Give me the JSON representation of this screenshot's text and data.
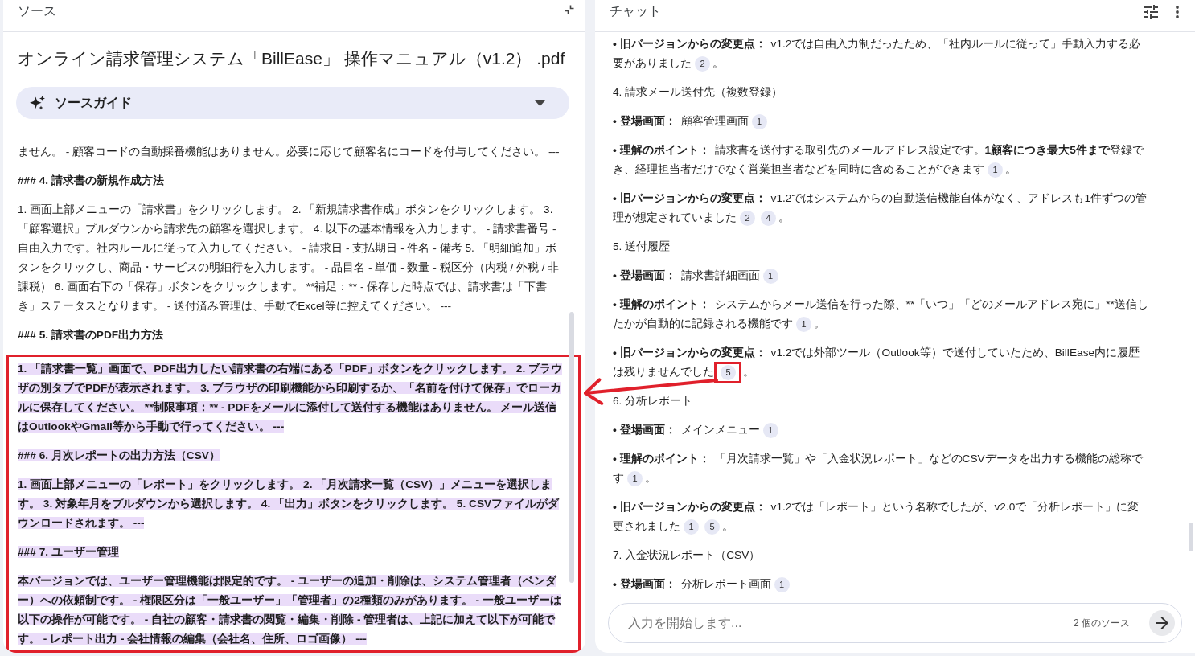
{
  "source_panel": {
    "title": "ソース",
    "document_title": "オンライン請求管理システム「BillEase」 操作マニュアル（v1.2） .pdf",
    "source_guide": {
      "label": "ソースガイド",
      "expanded": false
    },
    "blocks": [
      {
        "kind": "paragraph",
        "text": "ません。 - 顧客コードの自動採番機能はありません。必要に応じて顧客名にコードを付与してください。 ---",
        "highlighted": false,
        "annotated": false
      },
      {
        "kind": "heading",
        "text": "### 4. 請求書の新規作成方法",
        "highlighted": false,
        "annotated": false
      },
      {
        "kind": "paragraph",
        "text": "1. 画面上部メニューの「請求書」をクリックします。 2. 「新規請求書作成」ボタンをクリックします。 3. 「顧客選択」プルダウンから請求先の顧客を選択します。 4. 以下の基本情報を入力します。 - 請求書番号 - 自由入力です。社内ルールに従って入力してください。 - 請求日 - 支払期日 - 件名 - 備考 5. 「明細追加」ボタンをクリックし、商品・サービスの明細行を入力します。 - 品目名 - 単価 - 数量 - 税区分（内税 / 外税 / 非課税） 6. 画面右下の「保存」ボタンをクリックします。 **補足：** - 保存した時点では、請求書は「下書き」ステータスとなります。 - 送付済み管理は、手動でExcel等に控えてください。 ---",
        "highlighted": false,
        "annotated": false
      },
      {
        "kind": "heading",
        "text": "### 5. 請求書のPDF出力方法",
        "highlighted": false,
        "annotated": false
      },
      {
        "kind": "paragraph",
        "text": "1. 「請求書一覧」画面で、PDF出力したい請求書の右端にある「PDF」ボタンをクリックします。 2. ブラウザの別タブでPDFが表示されます。 3. ブラウザの印刷機能から印刷するか、「名前を付けて保存」でローカルに保存してください。 **制限事項：** - PDFをメールに添付して送付する機能はありません。 メール送信はOutlookやGmail等から手動で行ってください。 ---",
        "highlighted": true,
        "annotated": true
      },
      {
        "kind": "heading",
        "text": "### 6. 月次レポートの出力方法（CSV）",
        "highlighted": true,
        "annotated": true
      },
      {
        "kind": "paragraph",
        "text": "1. 画面上部メニューの「レポート」をクリックします。 2. 「月次請求一覧（CSV）」メニューを選択します。 3. 対象年月をプルダウンから選択します。 4. 「出力」ボタンをクリックします。 5. CSVファイルがダウンロードされます。 ---",
        "highlighted": true,
        "annotated": true
      },
      {
        "kind": "heading",
        "text": "### 7. ユーザー管理",
        "highlighted": true,
        "annotated": true
      },
      {
        "kind": "paragraph",
        "text": "本バージョンでは、ユーザー管理機能は限定的です。 - ユーザーの追加・削除は、システム管理者（ベンダー）への依頼制です。 - 権限区分は「一般ユーザー」「管理者」の2種類のみがあります。 - 一般ユーザーは以下の操作が可能です。 - 自社の顧客・請求書の閲覧・編集・削除 - 管理者は、上記に加えて以下が可能です。 - レポート出力 - 会社情報の編集（会社名、住所、ロゴ画像） ---",
        "highlighted": true,
        "annotated": true
      }
    ]
  },
  "chat_panel": {
    "title": "チャット",
    "blocks": [
      {
        "kind": "item",
        "label": "• 旧バージョンからの変更点：",
        "segments": [
          {
            "text": "v1.2では自由入力制だったため、「社内ルールに従って」手動入力する必要がありました",
            "bold": false
          }
        ],
        "citations": [
          {
            "label": "2",
            "marked": false
          }
        ],
        "end": "。"
      },
      {
        "kind": "heading",
        "text": "4. 請求メール送付先（複数登録）"
      },
      {
        "kind": "item",
        "label": "• 登場画面：",
        "segments": [
          {
            "text": "顧客管理画面",
            "bold": false
          }
        ],
        "citations": [
          {
            "label": "1",
            "marked": false
          }
        ]
      },
      {
        "kind": "item",
        "label": "• 理解のポイント：",
        "segments": [
          {
            "text": "請求書を送付する取引先のメールアドレス設定です。",
            "bold": false
          },
          {
            "text": "1顧客につき最大5件まで",
            "bold": true
          },
          {
            "text": "登録でき、経理担当者だけでなく営業担当者などを同時に含めることができます",
            "bold": false
          }
        ],
        "citations": [
          {
            "label": "1",
            "marked": false
          }
        ],
        "end": "。"
      },
      {
        "kind": "item",
        "label": "• 旧バージョンからの変更点：",
        "segments": [
          {
            "text": "v1.2ではシステムからの自動送信機能自体がなく、アドレスも1件ずつの管理が想定されていました",
            "bold": false
          }
        ],
        "citations": [
          {
            "label": "2",
            "marked": false
          },
          {
            "label": "4",
            "marked": false
          }
        ],
        "end": "。"
      },
      {
        "kind": "heading",
        "text": "5. 送付履歴"
      },
      {
        "kind": "item",
        "label": "• 登場画面：",
        "segments": [
          {
            "text": "請求書詳細画面",
            "bold": false
          }
        ],
        "citations": [
          {
            "label": "1",
            "marked": false
          }
        ]
      },
      {
        "kind": "item",
        "label": "• 理解のポイント：",
        "segments": [
          {
            "text": "システムからメール送信を行った際、**「いつ」「どのメールアドレス宛に」**送信したかが自動的に記録される機能です",
            "bold": false
          }
        ],
        "citations": [
          {
            "label": "1",
            "marked": false
          }
        ],
        "end": "。"
      },
      {
        "kind": "item",
        "label": "• 旧バージョンからの変更点：",
        "segments": [
          {
            "text": "v1.2では外部ツール（Outlook等）で送付していたため、BillEase内に履歴は残りませんでした",
            "bold": false
          }
        ],
        "citations": [
          {
            "label": "5",
            "marked": true
          }
        ],
        "end": "。"
      },
      {
        "kind": "heading",
        "text": "6. 分析レポート"
      },
      {
        "kind": "item",
        "label": "• 登場画面：",
        "segments": [
          {
            "text": "メインメニュー",
            "bold": false
          }
        ],
        "citations": [
          {
            "label": "1",
            "marked": false
          }
        ]
      },
      {
        "kind": "item",
        "label": "• 理解のポイント：",
        "segments": [
          {
            "text": "「月次請求一覧」や「入金状況レポート」などのCSVデータを出力する機能の総称です",
            "bold": false
          }
        ],
        "citations": [
          {
            "label": "1",
            "marked": false
          }
        ],
        "end": "。"
      },
      {
        "kind": "item",
        "label": "• 旧バージョンからの変更点：",
        "segments": [
          {
            "text": "v1.2では「レポート」という名称でしたが、v2.0で「分析レポート」に変更されました",
            "bold": false
          }
        ],
        "citations": [
          {
            "label": "1",
            "marked": false
          },
          {
            "label": "5",
            "marked": false
          }
        ],
        "end": "。"
      },
      {
        "kind": "heading",
        "text": "7. 入金状況レポート（CSV）"
      },
      {
        "kind": "item",
        "label": "• 登場画面：",
        "segments": [
          {
            "text": "分析レポート画面",
            "bold": false
          }
        ],
        "citations": [
          {
            "label": "1",
            "marked": false
          }
        ]
      }
    ],
    "composer": {
      "placeholder": "入力を開始します...",
      "source_count": "2 個のソース"
    }
  }
}
